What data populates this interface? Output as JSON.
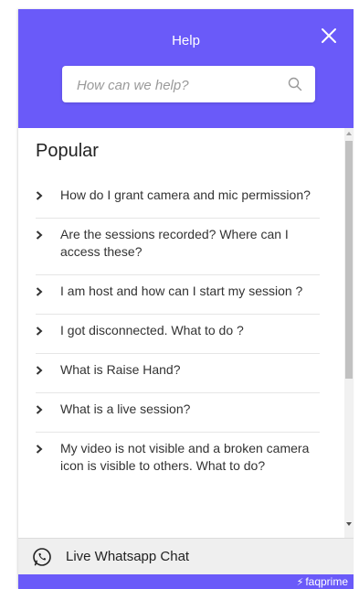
{
  "header": {
    "title": "Help",
    "close_icon": "close-icon",
    "search": {
      "placeholder": "How can we help?",
      "value": "",
      "icon": "search-icon"
    }
  },
  "section": {
    "title": "Popular"
  },
  "faqs": [
    {
      "label": "How do I grant camera and mic permission?"
    },
    {
      "label": "Are the sessions recorded? Where can I access these?"
    },
    {
      "label": "I am host and how can I start my session ?"
    },
    {
      "label": "I got disconnected. What to do ?"
    },
    {
      "label": "What is Raise Hand?"
    },
    {
      "label": "What is a live session?"
    },
    {
      "label": "My video is not visible and a broken camera icon is visible to others. What to do?"
    }
  ],
  "chat": {
    "label": "Live Whatsapp Chat",
    "icon": "whatsapp-icon"
  },
  "footer": {
    "brand": "faqprime",
    "brand_icon": "bolt-icon"
  },
  "colors": {
    "accent": "#6a5af9",
    "chat_bg": "#efefef",
    "text": "#333333"
  }
}
